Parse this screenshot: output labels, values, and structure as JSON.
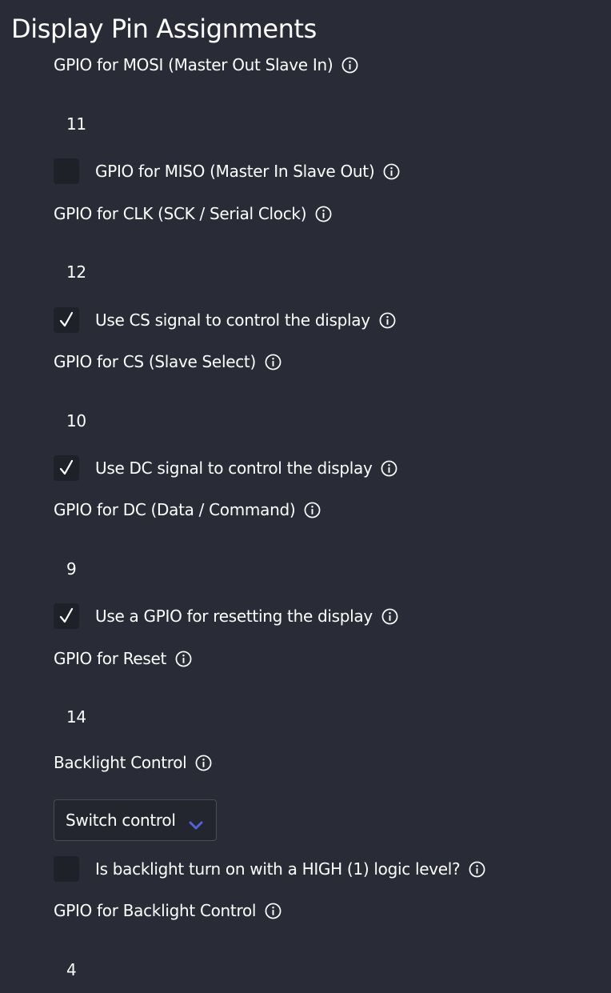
{
  "page": {
    "title": "Display Pin Assignments"
  },
  "fields": {
    "mosi": {
      "label": "GPIO for MOSI (Master Out Slave In)",
      "value": "11"
    },
    "miso": {
      "label": "GPIO for MISO (Master In Slave Out)",
      "checked": false
    },
    "clk": {
      "label": "GPIO for CLK (SCK / Serial Clock)",
      "value": "12"
    },
    "use_cs": {
      "label": "Use CS signal to control the display",
      "checked": true
    },
    "cs": {
      "label": "GPIO for CS (Slave Select)",
      "value": "10"
    },
    "use_dc": {
      "label": "Use DC signal to control the display",
      "checked": true
    },
    "dc": {
      "label": "GPIO for DC (Data / Command)",
      "value": "9"
    },
    "use_reset": {
      "label": "Use a GPIO for resetting the display",
      "checked": true
    },
    "reset": {
      "label": "GPIO for Reset",
      "value": "14"
    },
    "backlight_control": {
      "label": "Backlight Control",
      "selected": "Switch control"
    },
    "backlight_high": {
      "label": "Is backlight turn on with a HIGH (1) logic level?",
      "checked": false
    },
    "backlight_gpio": {
      "label": "GPIO for Backlight Control",
      "value": "4"
    }
  },
  "icons": {
    "info": "info-circle-icon",
    "check": "checkmark-icon",
    "dropdown": "chevron-down-icon"
  },
  "colors": {
    "background": "#292b37",
    "checkbox_bg": "#1f2128",
    "chevron": "#5562d6",
    "text": "#ffffff"
  }
}
